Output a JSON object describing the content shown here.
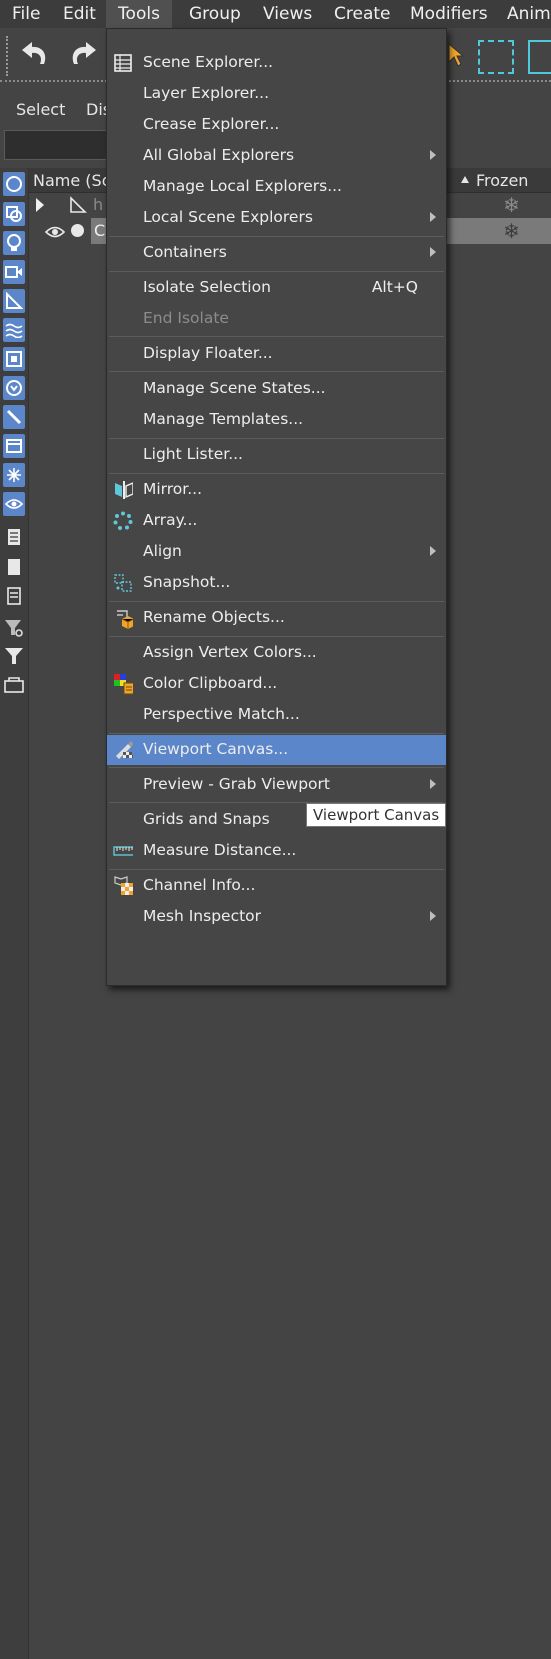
{
  "menubar": {
    "items": [
      {
        "label": "File"
      },
      {
        "label": "Edit"
      },
      {
        "label": "Tools"
      },
      {
        "label": "Group"
      },
      {
        "label": "Views"
      },
      {
        "label": "Create"
      },
      {
        "label": "Modifiers"
      },
      {
        "label": "Anima"
      }
    ],
    "active": "Tools"
  },
  "explorer": {
    "tabs": [
      {
        "label": "Select"
      },
      {
        "label": "Dis"
      }
    ],
    "columns": {
      "name": "Name (Sor",
      "frozen": "Frozen"
    },
    "rows": [
      {
        "name": "h",
        "frozen_icon": "snowflake-icon"
      },
      {
        "name": "C",
        "frozen_icon": "snowflake-icon",
        "selected": true
      }
    ]
  },
  "tools_menu": {
    "items": [
      {
        "label": "Scene Explorer...",
        "icon": "table-icon"
      },
      {
        "label": "Layer Explorer..."
      },
      {
        "label": "Crease Explorer..."
      },
      {
        "label": "All Global Explorers",
        "submenu": true
      },
      {
        "label": "Manage Local Explorers..."
      },
      {
        "label": "Local Scene Explorers",
        "submenu": true
      },
      {
        "label": "Containers",
        "submenu": true
      },
      {
        "label": "Isolate Selection",
        "shortcut": "Alt+Q"
      },
      {
        "label": "End Isolate",
        "disabled": true
      },
      {
        "label": "Display Floater..."
      },
      {
        "label": "Manage Scene States..."
      },
      {
        "label": "Manage Templates..."
      },
      {
        "label": "Light Lister..."
      },
      {
        "label": "Mirror...",
        "icon": "mirror-icon"
      },
      {
        "label": "Array...",
        "icon": "array-icon"
      },
      {
        "label": "Align",
        "submenu": true
      },
      {
        "label": "Snapshot...",
        "icon": "snapshot-icon"
      },
      {
        "label": "Rename Objects...",
        "icon": "rename-icon"
      },
      {
        "label": "Assign Vertex Colors..."
      },
      {
        "label": "Color Clipboard...",
        "icon": "color-clipboard-icon"
      },
      {
        "label": "Perspective Match..."
      },
      {
        "label": "Viewport Canvas...",
        "icon": "viewport-canvas-icon",
        "hover": true
      },
      {
        "label": "Preview - Grab Viewport",
        "submenu": true
      },
      {
        "label": "Grids and Snaps",
        "submenu": true
      },
      {
        "label": "Measure Distance...",
        "icon": "measure-icon"
      },
      {
        "label": "Channel Info...",
        "icon": "channel-info-icon"
      },
      {
        "label": "Mesh Inspector",
        "submenu": true
      }
    ]
  },
  "tooltip": {
    "text": "Viewport Canvas"
  },
  "colors": {
    "accent": "#5b86c9",
    "background": "#444444",
    "menu_bg": "#464646"
  }
}
